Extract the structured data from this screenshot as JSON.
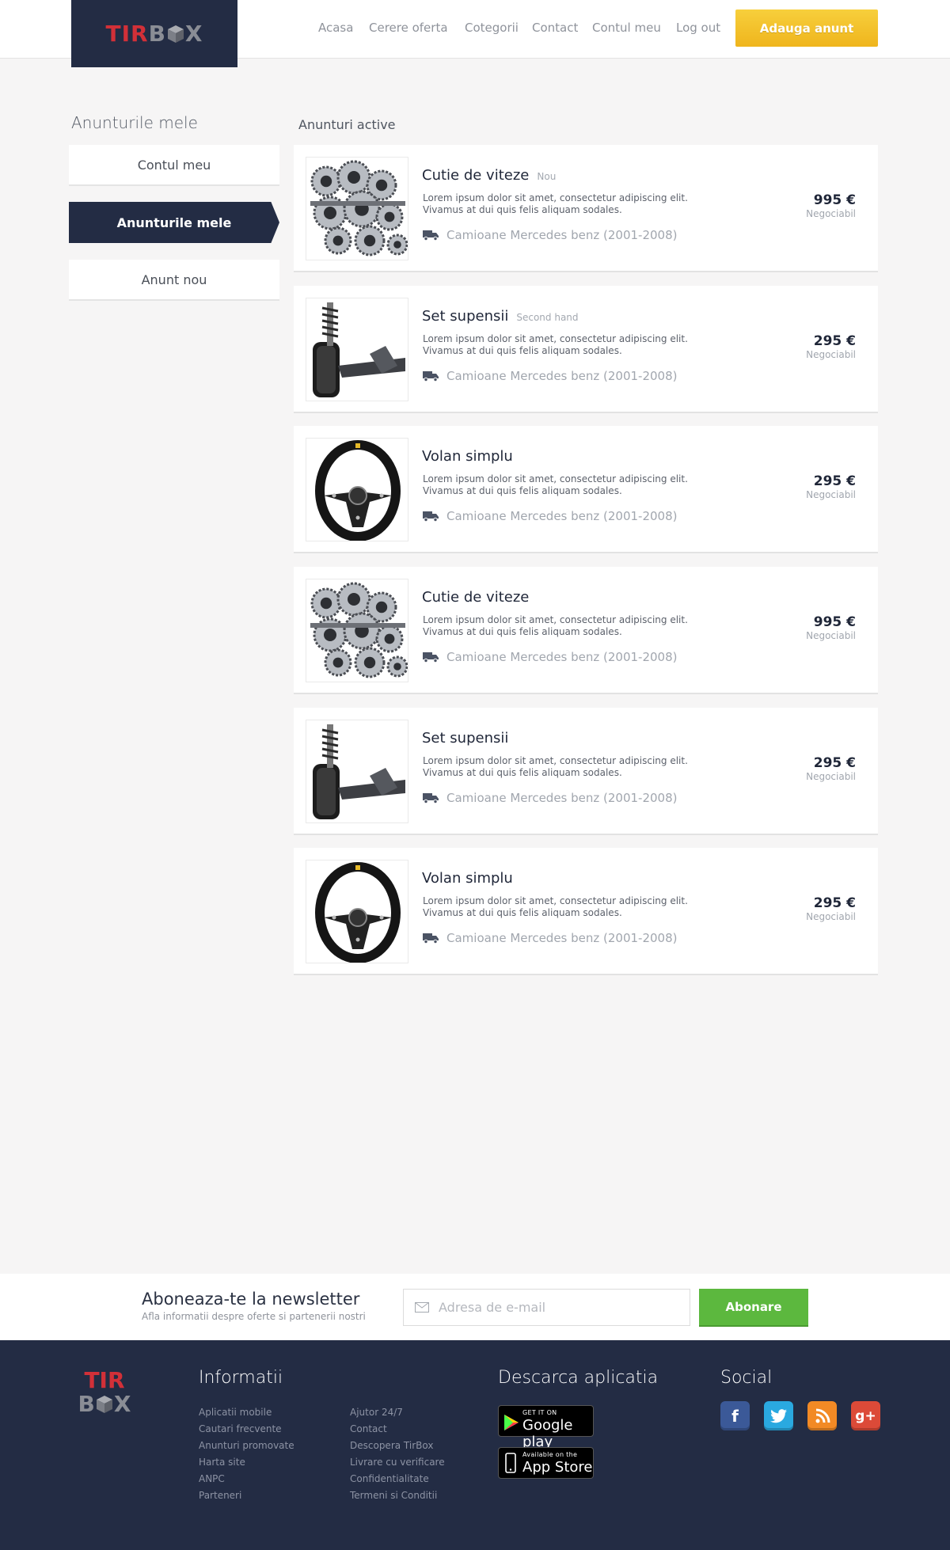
{
  "header": {
    "logo": {
      "part1": "TIR",
      "part2": "B",
      "part3": "X"
    },
    "nav": [
      "Acasa",
      "Cerere oferta",
      "Cotegorii",
      "Contact",
      "Contul meu",
      "Log out"
    ],
    "add_button": "Adauga anunt"
  },
  "sidebar": {
    "title": "Anunturile mele",
    "items": [
      "Contul meu",
      "Anunturile mele",
      "Anunt nou"
    ],
    "active_index": 1
  },
  "main": {
    "title": "Anunturi active",
    "listings": [
      {
        "title": "Cutie de viteze",
        "badge": "Nou",
        "desc": "Lorem ipsum dolor sit amet, consectetur adipiscing elit. Vivamus at dui quis felis aliquam sodales.",
        "category": "Camioane Mercedes benz (2001-2008)",
        "price": "995 €",
        "price_note": "Negociabil",
        "image": "gearbox"
      },
      {
        "title": "Set supensii",
        "badge": "Second hand",
        "desc": "Lorem ipsum dolor sit amet, consectetur adipiscing elit. Vivamus at dui quis felis aliquam sodales.",
        "category": "Camioane Mercedes benz (2001-2008)",
        "price": "295 €",
        "price_note": "Negociabil",
        "image": "suspension"
      },
      {
        "title": "Volan simplu",
        "badge": "",
        "desc": "Lorem ipsum dolor sit amet, consectetur adipiscing elit. Vivamus at dui quis felis aliquam sodales.",
        "category": "Camioane Mercedes benz (2001-2008)",
        "price": "295 €",
        "price_note": "Negociabil",
        "image": "steering-wheel"
      },
      {
        "title": "Cutie de viteze",
        "badge": "",
        "desc": "Lorem ipsum dolor sit amet, consectetur adipiscing elit. Vivamus at dui quis felis aliquam sodales.",
        "category": "Camioane Mercedes benz (2001-2008)",
        "price": "995 €",
        "price_note": "Negociabil",
        "image": "gearbox"
      },
      {
        "title": "Set supensii",
        "badge": "",
        "desc": "Lorem ipsum dolor sit amet, consectetur adipiscing elit. Vivamus at dui quis felis aliquam sodales.",
        "category": "Camioane Mercedes benz (2001-2008)",
        "price": "295 €",
        "price_note": "Negociabil",
        "image": "suspension"
      },
      {
        "title": "Volan simplu",
        "badge": "",
        "desc": "Lorem ipsum dolor sit amet, consectetur adipiscing elit. Vivamus at dui quis felis aliquam sodales.",
        "category": "Camioane Mercedes benz (2001-2008)",
        "price": "295 €",
        "price_note": "Negociabil",
        "image": "steering-wheel"
      }
    ]
  },
  "newsletter": {
    "title": "Aboneaza-te la newsletter",
    "subtitle": "Afla informatii despre oferte si partenerii nostri",
    "placeholder": "Adresa de e-mail",
    "button": "Abonare"
  },
  "footer": {
    "info_title": "Informatii",
    "links_col1": [
      "Aplicatii mobile",
      "Cautari frecvente",
      "Anunturi promovate",
      "Harta site",
      "ANPC",
      "Parteneri"
    ],
    "links_col2": [
      "Ajutor 24/7",
      "Contact",
      "Descopera TirBox",
      "Livrare cu verificare",
      "Confidentialitate",
      "Termeni si Conditii"
    ],
    "app_title": "Descarca aplicatia",
    "google_play": {
      "small": "GET IT ON",
      "big": "Google play"
    },
    "app_store": {
      "small": "Available on the",
      "big": "App Store"
    },
    "social_title": "Social",
    "social": [
      "facebook-icon",
      "twitter-icon",
      "rss-icon",
      "google-plus-icon"
    ],
    "colors": {
      "brand_dark": "#232c44",
      "brand_red": "#d23038",
      "accent_yellow": "#f2c12b",
      "green": "#5cb83e"
    }
  }
}
